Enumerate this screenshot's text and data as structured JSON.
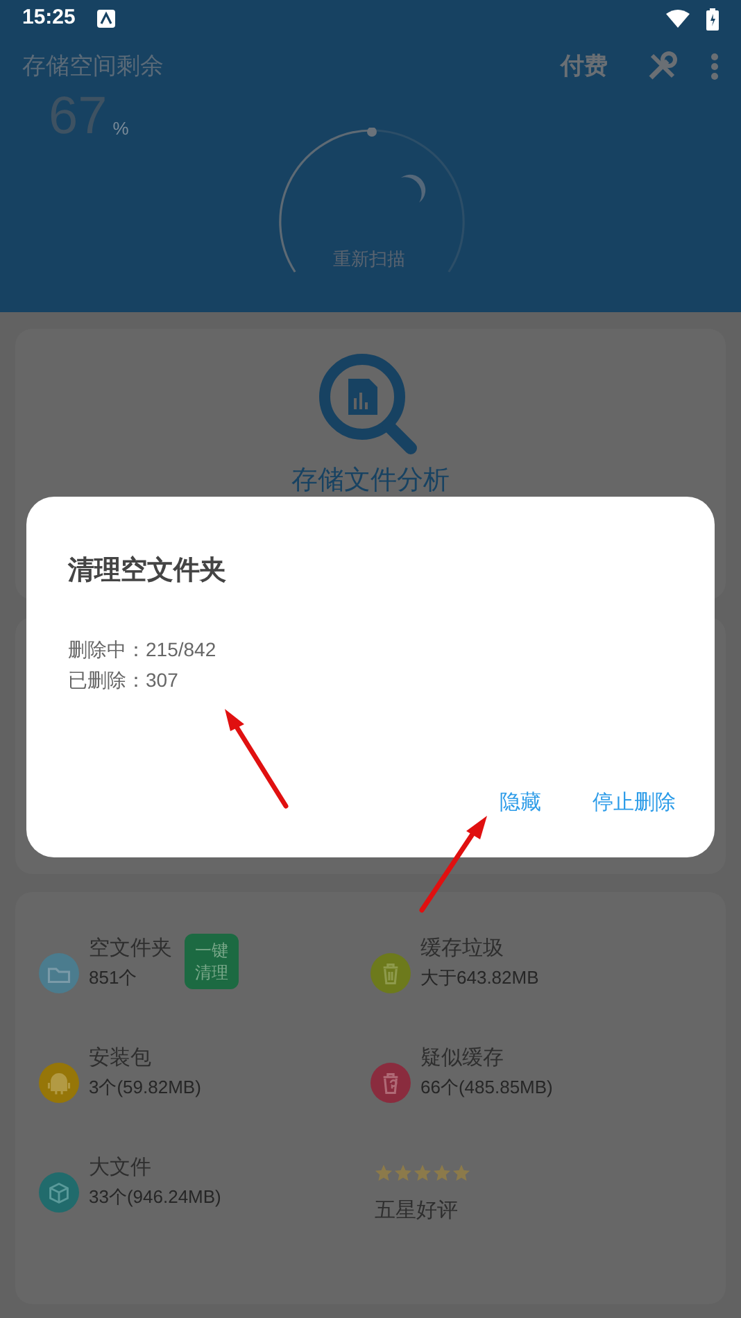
{
  "status_bar": {
    "time": "15:25"
  },
  "header": {
    "title": "存储空间剩余",
    "percent": "67",
    "unit": "%",
    "pay": "付费",
    "rescan": "重新扫描"
  },
  "analysis_card": {
    "label": "存储文件分析"
  },
  "dialog": {
    "title": "清理空文件夹",
    "lines": [
      "删除中：215/842",
      "已删除：307"
    ],
    "buttons": [
      "隐藏",
      "停止删除"
    ]
  },
  "categories": [
    {
      "kind": "folder",
      "name": "空文件夹",
      "detail": "851个",
      "color": "#4b7c8e",
      "action": "一键清理"
    },
    {
      "kind": "trash",
      "name": "缓存垃圾",
      "detail": "大于643.82MB",
      "color": "#6d7a1c"
    },
    {
      "kind": "android",
      "name": "安装包",
      "detail": "3个(59.82MB)",
      "color": "#967608"
    },
    {
      "kind": "suspect",
      "name": "疑似缓存",
      "detail": "66个(485.85MB)",
      "color": "#8a2c3e"
    },
    {
      "kind": "box",
      "name": "大文件",
      "detail": "33个(946.24MB)",
      "color": "#216b6c"
    },
    {
      "kind": "rating",
      "name": "五星好评",
      "stars": 5
    }
  ]
}
